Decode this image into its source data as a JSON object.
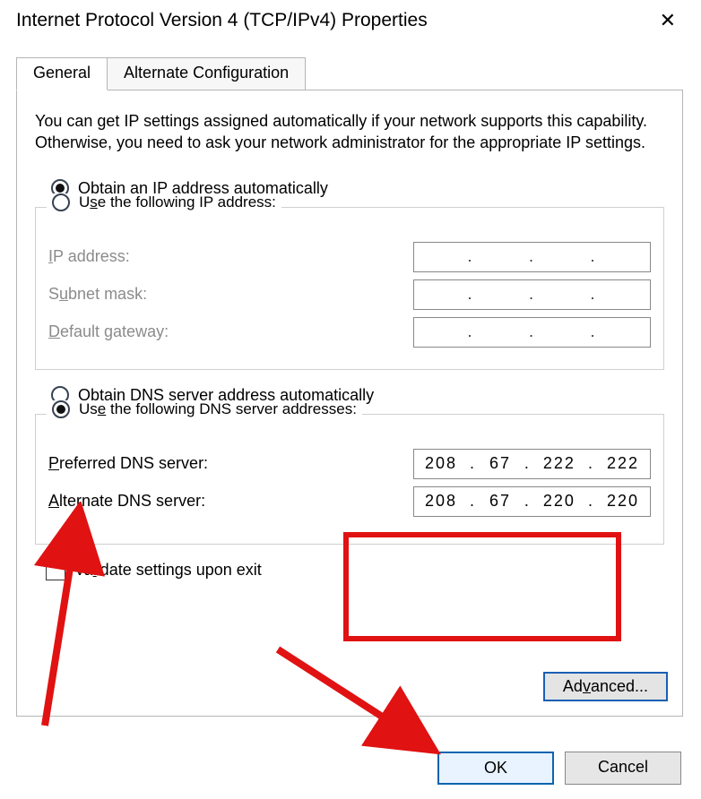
{
  "window": {
    "title": "Internet Protocol Version 4 (TCP/IPv4) Properties"
  },
  "tabs": {
    "general": "General",
    "alternate": "Alternate Configuration"
  },
  "description": "You can get IP settings assigned automatically if your network supports this capability. Otherwise, you need to ask your network administrator for the appropriate IP settings.",
  "ip_section": {
    "auto_label_pre": "O",
    "auto_label_post": "btain an IP address automatically",
    "manual_label_pre": "U",
    "manual_label_mid": "s",
    "manual_label_post": "e the following IP address:",
    "ip_address_label_pre": "I",
    "ip_address_label_post": "P address:",
    "subnet_label_pre": "S",
    "subnet_label_u": "u",
    "subnet_label_post": "bnet mask:",
    "gateway_label_pre": "",
    "gateway_label_u": "D",
    "gateway_label_post": "efault gateway:"
  },
  "dns_section": {
    "auto_label_pre": "O",
    "auto_label_u": "b",
    "auto_label_post": "tain DNS server address automatically",
    "manual_label_pre": "Us",
    "manual_label_u": "e",
    "manual_label_post": " the following DNS server addresses:",
    "preferred_label_u": "P",
    "preferred_label_post": "referred DNS server:",
    "alternate_label_u": "A",
    "alternate_label_post": "lternate DNS server:",
    "preferred": {
      "o1": "208",
      "o2": "67",
      "o3": "222",
      "o4": "222"
    },
    "alternate": {
      "o1": "208",
      "o2": "67",
      "o3": "220",
      "o4": "220"
    }
  },
  "validate_label_pre": "Va",
  "validate_label_u": "l",
  "validate_label_post": "idate settings upon exit",
  "advanced_label_pre": "Ad",
  "advanced_label_u": "v",
  "advanced_label_post": "anced...",
  "buttons": {
    "ok": "OK",
    "cancel": "Cancel"
  }
}
